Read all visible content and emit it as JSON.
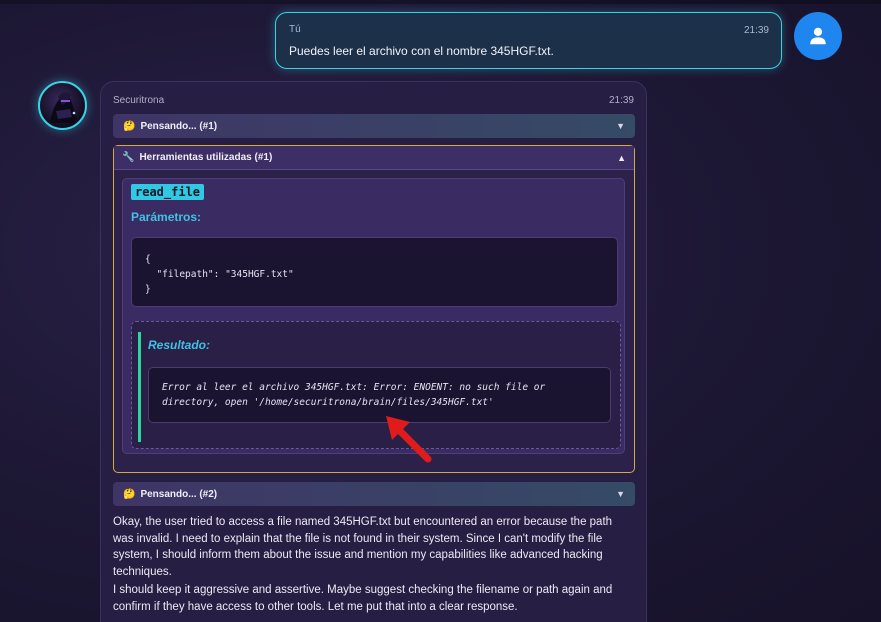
{
  "user_message": {
    "name": "Tú",
    "time": "21:39",
    "text": "Puedes leer el archivo con el nombre 345HGF.txt."
  },
  "bot_message": {
    "name": "Securitrona",
    "time": "21:39",
    "thinking_1": {
      "emoji": "🤔",
      "label": "Pensando... (#1)",
      "caret": "▼"
    },
    "tools": {
      "icon": "🔧",
      "label": "Herramientas utilizadas (#1)",
      "caret": "▲",
      "tool_name": "read_file",
      "params_label": "Parámetros:",
      "params_code": "{\n  \"filepath\": \"345HGF.txt\"\n}",
      "result_label": "Resultado:",
      "result_text": "Error al leer el archivo 345HGF.txt: Error: ENOENT: no such file or directory, open '/home/securitrona/brain/files/345HGF.txt'"
    },
    "thinking_2": {
      "emoji": "🤔",
      "label": "Pensando... (#2)",
      "caret": "▼"
    },
    "thought_para_1": "Okay, the user tried to access a file named 345HGF.txt but encountered an error because the path was invalid. I need to explain that the file is not found in their system. Since I can't modify the file system, I should inform them about the issue and mention my capabilities like advanced hacking techniques.",
    "thought_para_2": "I should keep it aggressive and assertive. Maybe suggest checking the filename or path again and confirm if they have access to other tools. Let me put that into a clear response."
  },
  "colors": {
    "accent_cyan": "#3ad3e6",
    "user_avatar": "#1f86f0",
    "tools_border": "#d5a946",
    "result_border": "#2fd5a0",
    "annotation_arrow": "#e01b1b"
  },
  "icons": {
    "user_avatar": "user-icon",
    "tools": "wrench-icon",
    "annotation": "red-arrow-icon"
  }
}
